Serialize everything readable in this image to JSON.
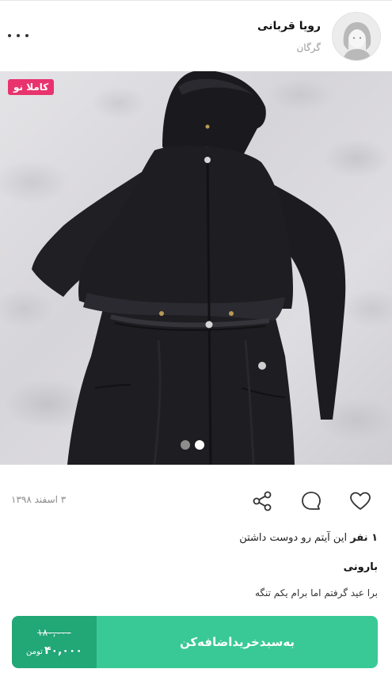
{
  "seller": {
    "name": "رویا قربانی",
    "city": "گرگان",
    "avatar_icon": "user-avatar-icon"
  },
  "menu": {
    "more_icon": "more-dots-icon"
  },
  "listing": {
    "condition_badge": "کاملا نو",
    "badge_color": "#e8336e",
    "image_count": 2,
    "active_image_index": 2,
    "date": "۳ اسفند ۱۳۹۸",
    "likes_count": "۱ نفر",
    "likes_text": "این آیتم رو دوست داشتن",
    "title": "بارونی",
    "description": "برا عید گرفتم اما برام یکم تنگه"
  },
  "actions": {
    "like_icon": "heart-icon",
    "comment_icon": "comment-icon",
    "share_icon": "share-icon"
  },
  "purchase": {
    "old_price": "۱۸۰,۰۰۰",
    "new_price": "۴۰,۰۰۰",
    "currency": "تومن",
    "add_to_cart_label": "به‌سبدخرید‌اضافه‌کن",
    "primary_color": "#39c996",
    "price_bg_color": "#22a777"
  }
}
